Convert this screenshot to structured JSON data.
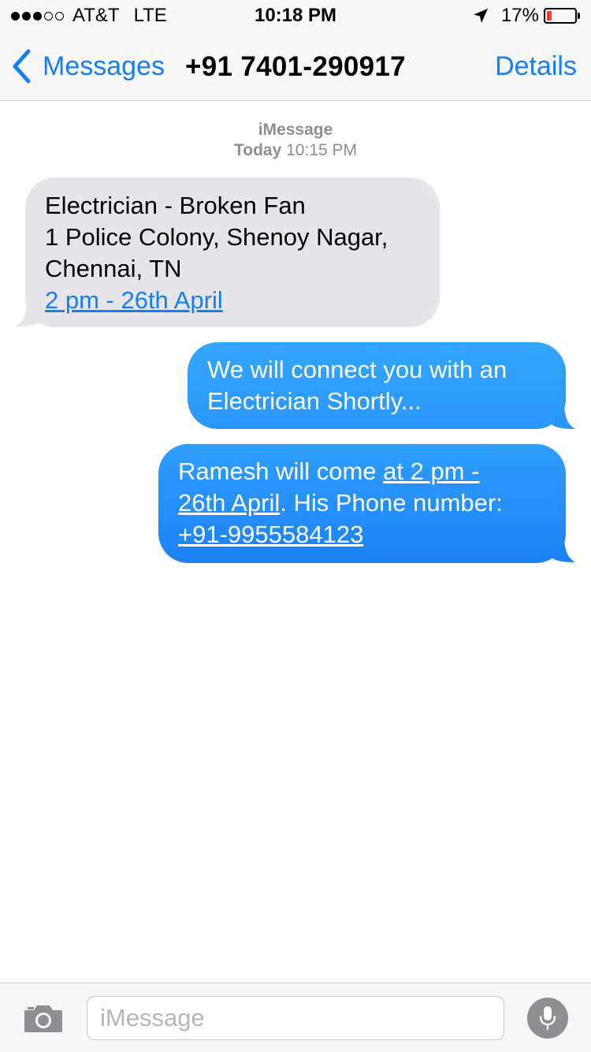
{
  "status_bar": {
    "carrier": "AT&T",
    "network": "LTE",
    "time": "10:18 PM",
    "battery_percent_text": "17%",
    "battery_level": 0.17,
    "signal_bars_filled": 3,
    "signal_bars_total": 5,
    "icons": [
      "signal-dots-icon",
      "location-arrow-icon",
      "battery-icon"
    ]
  },
  "nav": {
    "back_label": "Messages",
    "title": "+91 7401-290917",
    "details_label": "Details"
  },
  "thread_header": {
    "service": "iMessage",
    "day": "Today",
    "time": "10:15 PM"
  },
  "messages": [
    {
      "direction": "incoming",
      "lines": [
        "Electrician - Broken Fan",
        "1 Police Colony, Shenoy Nagar,",
        "Chennai, TN"
      ],
      "link": "2 pm - 26th April"
    },
    {
      "direction": "outgoing",
      "lines": [
        "We will connect you with an",
        "Electrician Shortly..."
      ]
    },
    {
      "direction": "outgoing",
      "line1_text": "Ramesh will come ",
      "line1_link": "at 2 pm -",
      "line2_link": "26th April",
      "line2_text": ". His Phone number:",
      "line3_link": "+91-9955584123"
    }
  ],
  "input": {
    "placeholder": "iMessage",
    "value": ""
  },
  "colors": {
    "accent": "#157efb",
    "incoming_bubble": "#e5e5ea",
    "outgoing_bubble": "#1c88f7",
    "battery_low": "#ff3b30"
  }
}
